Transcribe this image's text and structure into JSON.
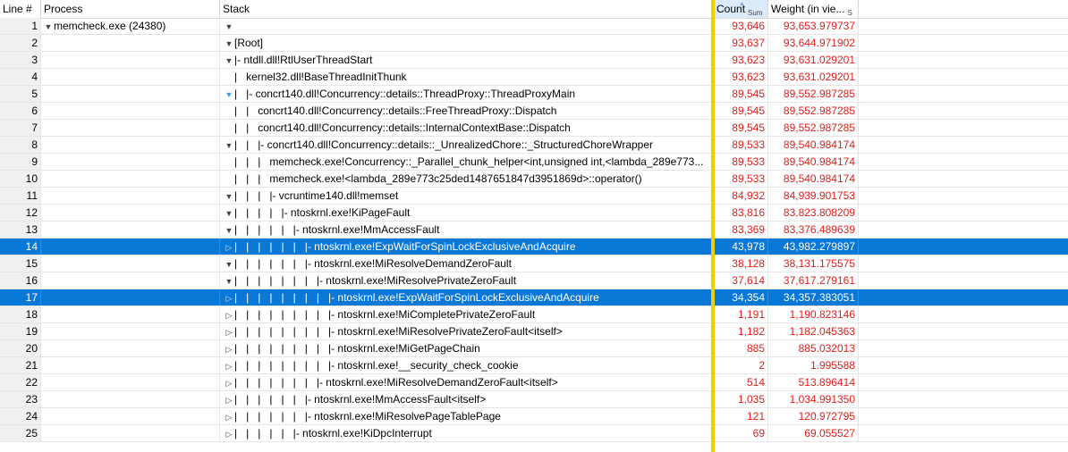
{
  "columns": {
    "line": "Line #",
    "process": "Process",
    "stack": "Stack",
    "count": "Count",
    "count_sub": "Sum",
    "weight": "Weight (in vie...",
    "weight_sub": "S"
  },
  "rows": [
    {
      "line": "1",
      "process": "memcheck.exe (24380)",
      "stack": "",
      "count": "93,646",
      "weight": "93,653.979737"
    },
    {
      "line": "2",
      "process": "",
      "stack": "[Root]",
      "count": "93,637",
      "weight": "93,644.971902"
    },
    {
      "line": "3",
      "process": "",
      "stack": "|- ntdll.dll!RtlUserThreadStart",
      "count": "93,623",
      "weight": "93,631.029201"
    },
    {
      "line": "4",
      "process": "",
      "stack": "|   kernel32.dll!BaseThreadInitThunk",
      "count": "93,623",
      "weight": "93,631.029201"
    },
    {
      "line": "5",
      "process": "",
      "stack": "|   |- concrt140.dll!Concurrency::details::ThreadProxy::ThreadProxyMain",
      "count": "89,545",
      "weight": "89,552.987285"
    },
    {
      "line": "6",
      "process": "",
      "stack": "|   |   concrt140.dll!Concurrency::details::FreeThreadProxy::Dispatch",
      "count": "89,545",
      "weight": "89,552.987285"
    },
    {
      "line": "7",
      "process": "",
      "stack": "|   |   concrt140.dll!Concurrency::details::InternalContextBase::Dispatch",
      "count": "89,545",
      "weight": "89,552.987285"
    },
    {
      "line": "8",
      "process": "",
      "stack": "|   |   |- concrt140.dll!Concurrency::details::_UnrealizedChore::_StructuredChoreWrapper",
      "count": "89,533",
      "weight": "89,540.984174"
    },
    {
      "line": "9",
      "process": "",
      "stack": "|   |   |   memcheck.exe!Concurrency::_Parallel_chunk_helper<int,unsigned int,<lambda_289e773...",
      "count": "89,533",
      "weight": "89,540.984174"
    },
    {
      "line": "10",
      "process": "",
      "stack": "|   |   |   memcheck.exe!<lambda_289e773c25ded1487651847d3951869d>::operator()",
      "count": "89,533",
      "weight": "89,540.984174"
    },
    {
      "line": "11",
      "process": "",
      "stack": "|   |   |   |- vcruntime140.dll!memset",
      "count": "84,932",
      "weight": "84,939.901753"
    },
    {
      "line": "12",
      "process": "",
      "stack": "|   |   |   |   |- ntoskrnl.exe!KiPageFault",
      "count": "83,816",
      "weight": "83,823.808209"
    },
    {
      "line": "13",
      "process": "",
      "stack": "|   |   |   |   |   |- ntoskrnl.exe!MmAccessFault",
      "count": "83,369",
      "weight": "83,376.489639"
    },
    {
      "line": "14",
      "process": "",
      "stack": "|   |   |   |   |   |   |- ntoskrnl.exe!ExpWaitForSpinLockExclusiveAndAcquire",
      "count": "43,978",
      "weight": "43,982.279897"
    },
    {
      "line": "15",
      "process": "",
      "stack": "|   |   |   |   |   |   |- ntoskrnl.exe!MiResolveDemandZeroFault",
      "count": "38,128",
      "weight": "38,131.175575"
    },
    {
      "line": "16",
      "process": "",
      "stack": "|   |   |   |   |   |   |   |- ntoskrnl.exe!MiResolvePrivateZeroFault",
      "count": "37,614",
      "weight": "37,617.279161"
    },
    {
      "line": "17",
      "process": "",
      "stack": "|   |   |   |   |   |   |   |   |- ntoskrnl.exe!ExpWaitForSpinLockExclusiveAndAcquire",
      "count": "34,354",
      "weight": "34,357.383051"
    },
    {
      "line": "18",
      "process": "",
      "stack": "|   |   |   |   |   |   |   |   |- ntoskrnl.exe!MiCompletePrivateZeroFault",
      "count": "1,191",
      "weight": "1,190.823146"
    },
    {
      "line": "19",
      "process": "",
      "stack": "|   |   |   |   |   |   |   |   |- ntoskrnl.exe!MiResolvePrivateZeroFault<itself>",
      "count": "1,182",
      "weight": "1,182.045363"
    },
    {
      "line": "20",
      "process": "",
      "stack": "|   |   |   |   |   |   |   |   |- ntoskrnl.exe!MiGetPageChain",
      "count": "885",
      "weight": "885.032013"
    },
    {
      "line": "21",
      "process": "",
      "stack": "|   |   |   |   |   |   |   |   |- ntoskrnl.exe!__security_check_cookie",
      "count": "2",
      "weight": "1.995588"
    },
    {
      "line": "22",
      "process": "",
      "stack": "|   |   |   |   |   |   |   |- ntoskrnl.exe!MiResolveDemandZeroFault<itself>",
      "count": "514",
      "weight": "513.896414"
    },
    {
      "line": "23",
      "process": "",
      "stack": "|   |   |   |   |   |   |- ntoskrnl.exe!MmAccessFault<itself>",
      "count": "1,035",
      "weight": "1,034.991350"
    },
    {
      "line": "24",
      "process": "",
      "stack": "|   |   |   |   |   |   |- ntoskrnl.exe!MiResolvePageTablePage",
      "count": "121",
      "weight": "120.972795"
    },
    {
      "line": "25",
      "process": "",
      "stack": "|   |   |   |   |   |- ntoskrnl.exe!KiDpcInterrupt",
      "count": "69",
      "weight": "69.055527"
    }
  ]
}
